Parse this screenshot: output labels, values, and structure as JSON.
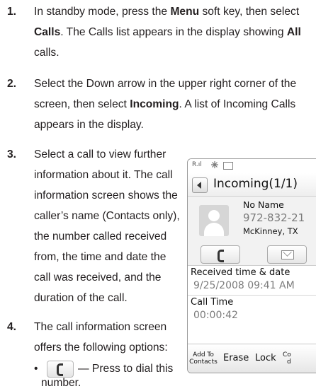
{
  "steps": [
    {
      "number": "1.",
      "lines": [
        [
          "In standby mode, press the ",
          {
            "b": "Menu"
          },
          " soft key, then select"
        ],
        [
          {
            "b": "Calls"
          },
          ". The Calls list appears in the display showing ",
          {
            "b": "All"
          }
        ],
        [
          "calls."
        ]
      ]
    },
    {
      "number": "2.",
      "lines": [
        [
          "Select the Down arrow in the upper right corner of the"
        ],
        [
          "screen, then select ",
          {
            "b": "Incoming"
          },
          ". A list of Incoming Calls"
        ],
        [
          "appears in the display."
        ]
      ]
    },
    {
      "number": "3.",
      "lines": [
        [
          "Select a call to view further"
        ],
        [
          "information about it. The call"
        ],
        [
          "information screen shows the"
        ],
        [
          "caller’s name (Contacts only),"
        ],
        [
          "the number called received"
        ],
        [
          "from, the time and date the"
        ],
        [
          "call was received, and the"
        ],
        [
          "duration of the call."
        ]
      ]
    },
    {
      "number": "4.",
      "lines": [
        [
          "The call information screen"
        ],
        [
          "offers the following options:"
        ]
      ]
    }
  ],
  "bullet": {
    "symbol": "•",
    "text_line1": "— Press to dial this",
    "text_line2": "number.",
    "icon": "call-handset-icon"
  },
  "phone": {
    "status_signal": "R.ıl",
    "title": "Incoming(1/1)",
    "contact_name": "No Name",
    "contact_number": "972-832-21",
    "contact_location": "McKinney, TX",
    "received_label": "Received time & date",
    "received_value": "9/25/2008 09:41 AM",
    "call_time_label": "Call Time",
    "call_time_value": "00:00:42",
    "softkeys": {
      "add_to_contacts_line1": "Add To",
      "add_to_contacts_line2": "Contacts",
      "erase": "Erase",
      "lock": "Lock",
      "copy_line1": "Co",
      "copy_line2": "d"
    }
  }
}
